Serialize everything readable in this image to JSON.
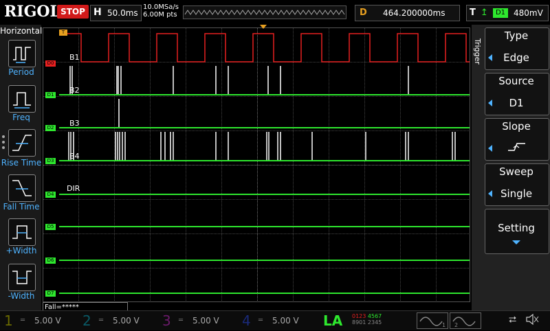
{
  "brand": "RIGOL",
  "run_state": "STOP",
  "timebase": {
    "label": "H",
    "value": "50.0ms"
  },
  "sample": {
    "rate": "10.0MSa/s",
    "points": "6.00M pts"
  },
  "delay": {
    "label": "D",
    "value": "464.200000ms"
  },
  "trigger_status": {
    "label": "T",
    "source": "D1",
    "level": "480mV"
  },
  "left_menu": {
    "title": "Horizontal",
    "items": [
      "Period",
      "Freq",
      "Rise Time",
      "Fall Time",
      "+Width",
      "-Width"
    ]
  },
  "channels": [
    {
      "tag": "D0",
      "name": "B1",
      "color": "#e82020"
    },
    {
      "tag": "D1",
      "name": "B2",
      "color": "#2ee82e"
    },
    {
      "tag": "D2",
      "name": "B3",
      "color": "#2ee82e"
    },
    {
      "tag": "D3",
      "name": "B4",
      "color": "#2ee82e"
    },
    {
      "tag": "D4",
      "name": "DIR",
      "color": "#2ee82e"
    },
    {
      "tag": "D5",
      "name": "",
      "color": "#2ee82e"
    },
    {
      "tag": "D6",
      "name": "",
      "color": "#2ee82e"
    },
    {
      "tag": "D7",
      "name": "",
      "color": "#2ee82e"
    }
  ],
  "trigger_menu": {
    "title": "Trigger",
    "type_label": "Type",
    "type_value": "Edge",
    "source_label": "Source",
    "source_value": "D1",
    "slope_label": "Slope",
    "sweep_label": "Sweep",
    "sweep_value": "Single",
    "setting_label": "Setting"
  },
  "measure": "Fall=*****",
  "bottom": {
    "ch": [
      {
        "num": "1",
        "scale": "5.00 V",
        "color": "#d4d400"
      },
      {
        "num": "2",
        "scale": "5.00 V",
        "color": "#00c8e8"
      },
      {
        "num": "3",
        "scale": "5.00 V",
        "color": "#e040e0"
      },
      {
        "num": "4",
        "scale": "5.00 V",
        "color": "#3a6cff"
      }
    ],
    "la": "LA",
    "la_row1_a": "0123",
    "la_row1_b": "4567",
    "la_row2_a": "8901",
    "la_row2_b": "2345"
  },
  "colors": {
    "accent": "#4fb3ff",
    "digital": "#2ee82e",
    "d0": "#e82020",
    "stop": "#d11a1a"
  }
}
